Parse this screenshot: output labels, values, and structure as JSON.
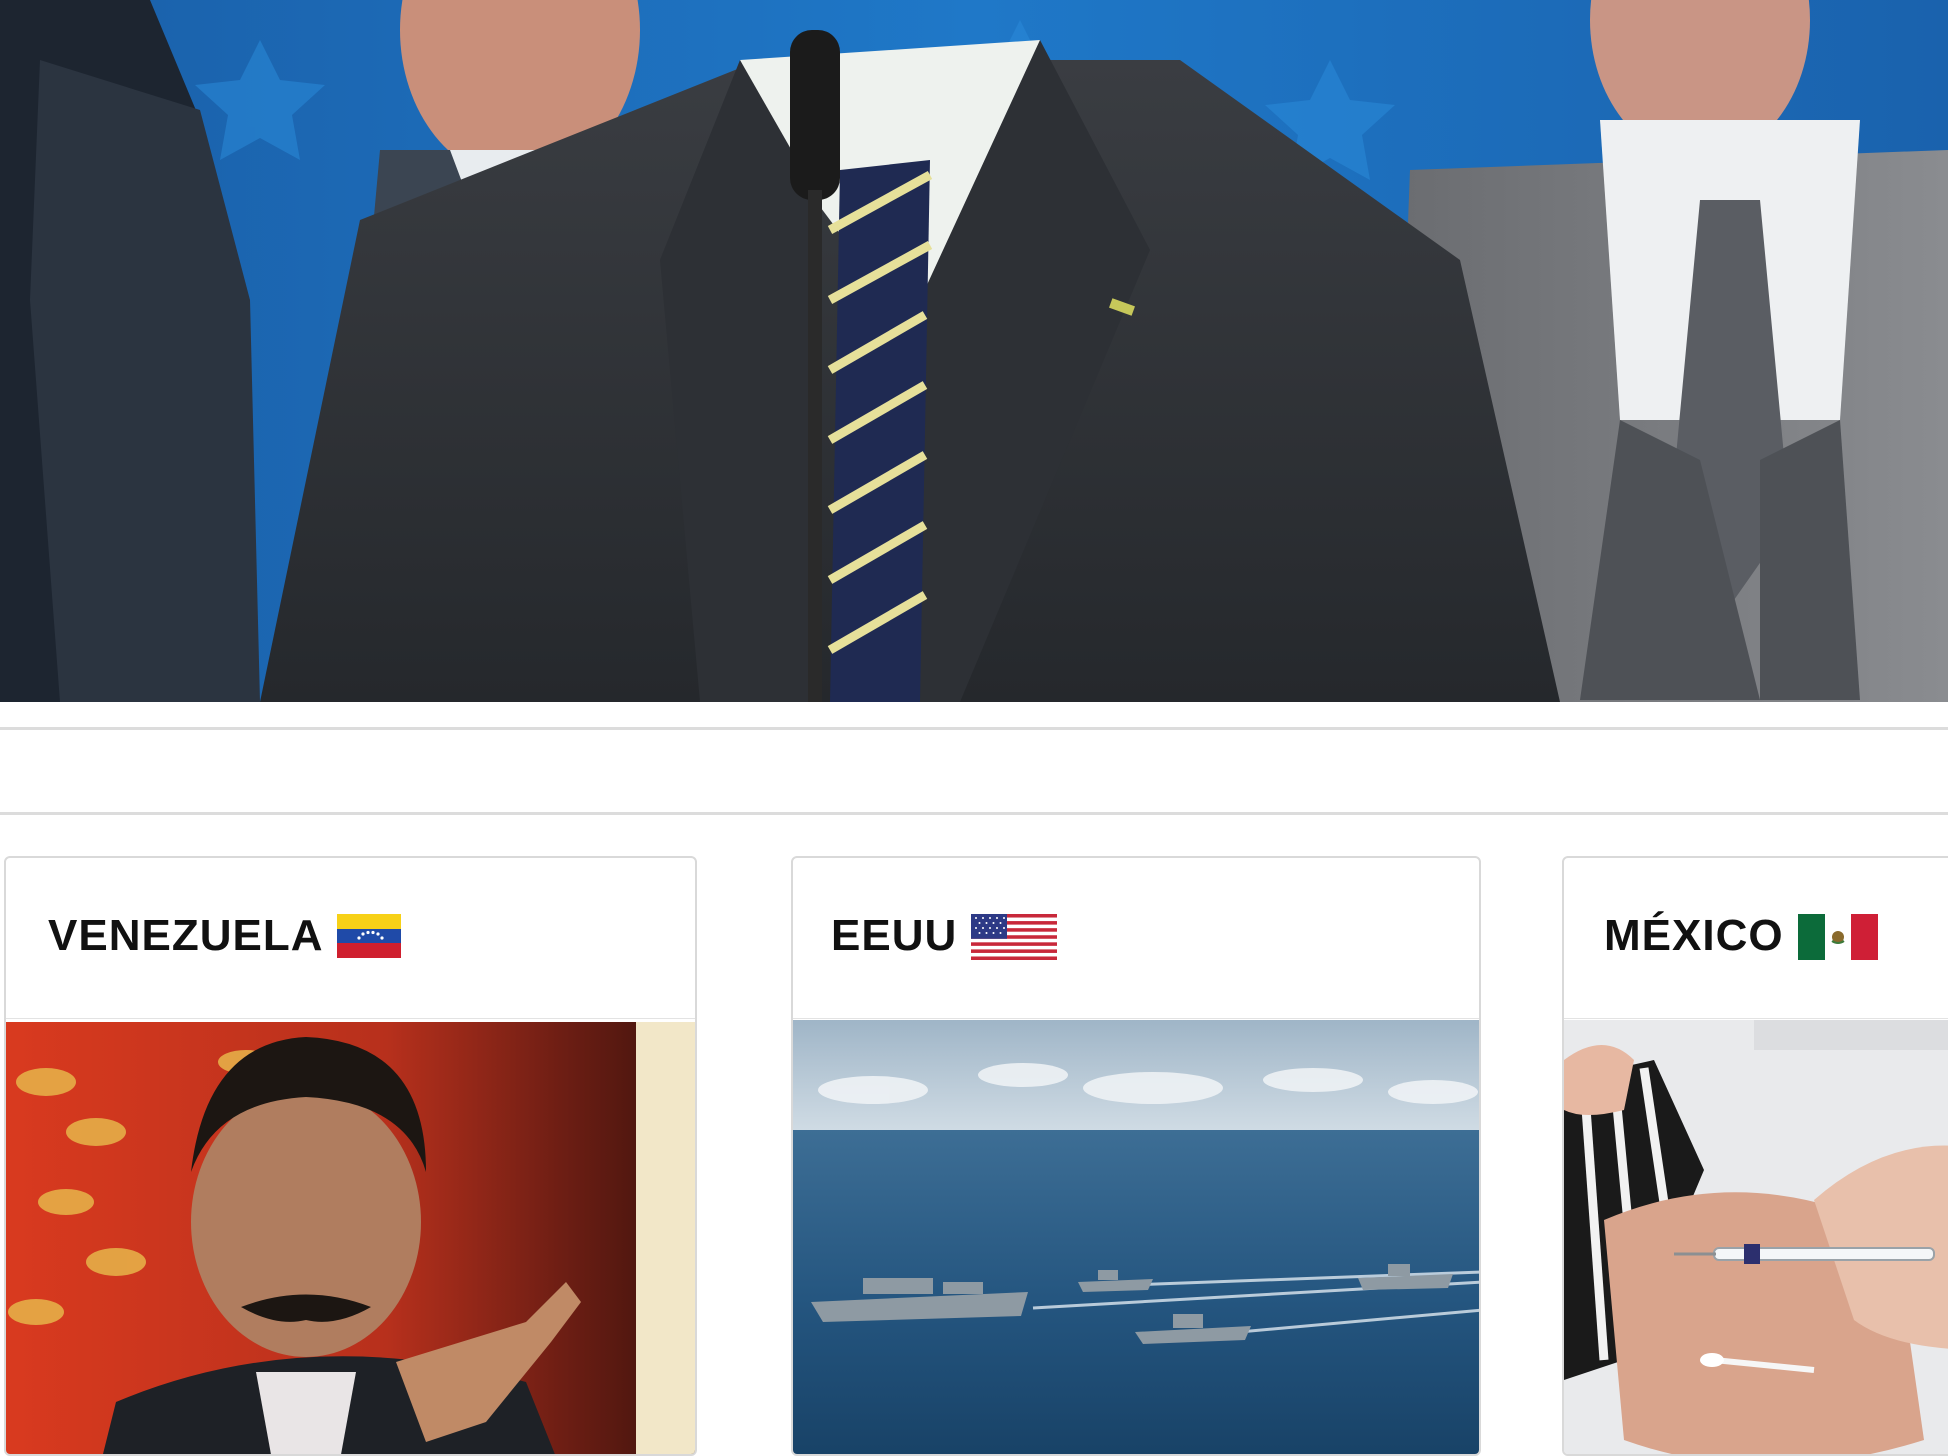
{
  "hero": {
    "image_description_icon": "press-conference-photo"
  },
  "cards": [
    {
      "title": "VENEZUELA",
      "flag_icon": "venezuela-flag-icon",
      "image_icon": "leader-pointing-photo"
    },
    {
      "title": "EEUU",
      "flag_icon": "usa-flag-icon",
      "image_icon": "naval-fleet-photo"
    },
    {
      "title": "MÉXICO",
      "flag_icon": "mexico-flag-icon",
      "image_icon": "vaccination-photo"
    }
  ],
  "colors": {
    "rule": "#dcdcdc",
    "card_border": "#d9d9d9",
    "title_text": "#111111"
  }
}
